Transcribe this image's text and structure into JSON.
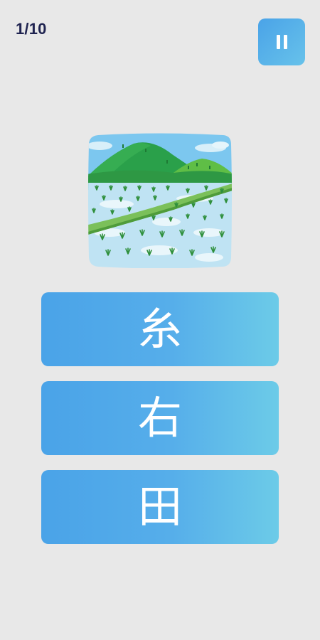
{
  "header": {
    "progress": "1/10"
  },
  "question": {
    "image_subject": "rice-field-landscape"
  },
  "answers": [
    {
      "label": "糸"
    },
    {
      "label": "右"
    },
    {
      "label": "田"
    }
  ],
  "colors": {
    "background": "#e8e8e8",
    "button_start": "#4aa3e8",
    "button_end": "#6ccbe8",
    "progress_text": "#1f2350"
  }
}
